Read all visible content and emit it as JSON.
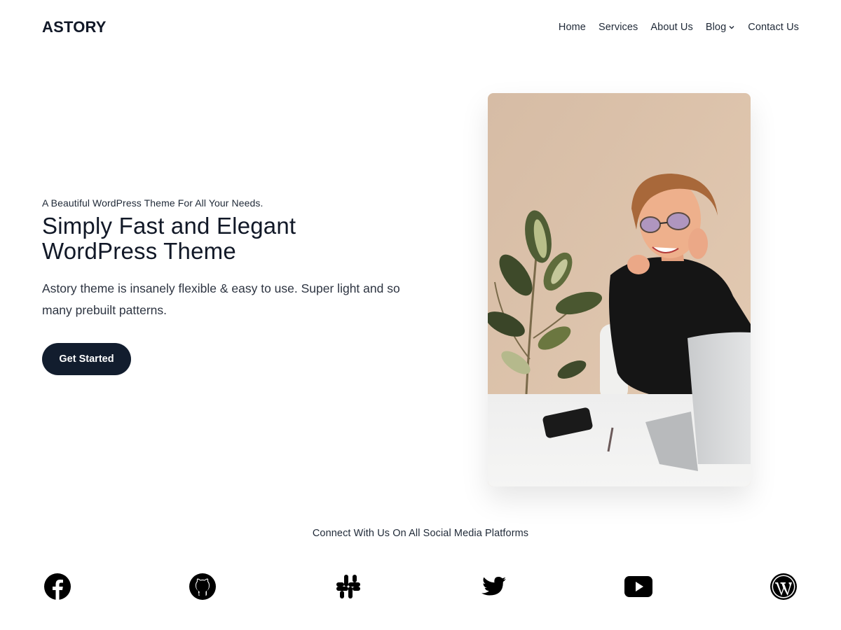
{
  "site": {
    "logo": "ASTORY"
  },
  "nav": {
    "items": [
      {
        "label": "Home"
      },
      {
        "label": "Services"
      },
      {
        "label": "About Us"
      },
      {
        "label": "Blog"
      },
      {
        "label": "Contact Us"
      }
    ],
    "dropdown_icon": "chevron-down-icon"
  },
  "hero": {
    "eyebrow": "A Beautiful WordPress Theme For All Your Needs.",
    "headline_line1": "Simply Fast and Elegant",
    "headline_line2": "WordPress Theme",
    "subtext": "Astory theme is insanely flexible & easy to use. Super light and so many prebuilt patterns.",
    "cta_label": "Get Started"
  },
  "social": {
    "heading": "Connect With Us On All Social Media Platforms",
    "icons": [
      "facebook-icon",
      "github-icon",
      "slack-icon",
      "twitter-icon",
      "youtube-icon",
      "wordpress-icon"
    ]
  },
  "colors": {
    "button_bg": "#121d2e",
    "text": "#1e2530",
    "background": "#ffffff"
  }
}
